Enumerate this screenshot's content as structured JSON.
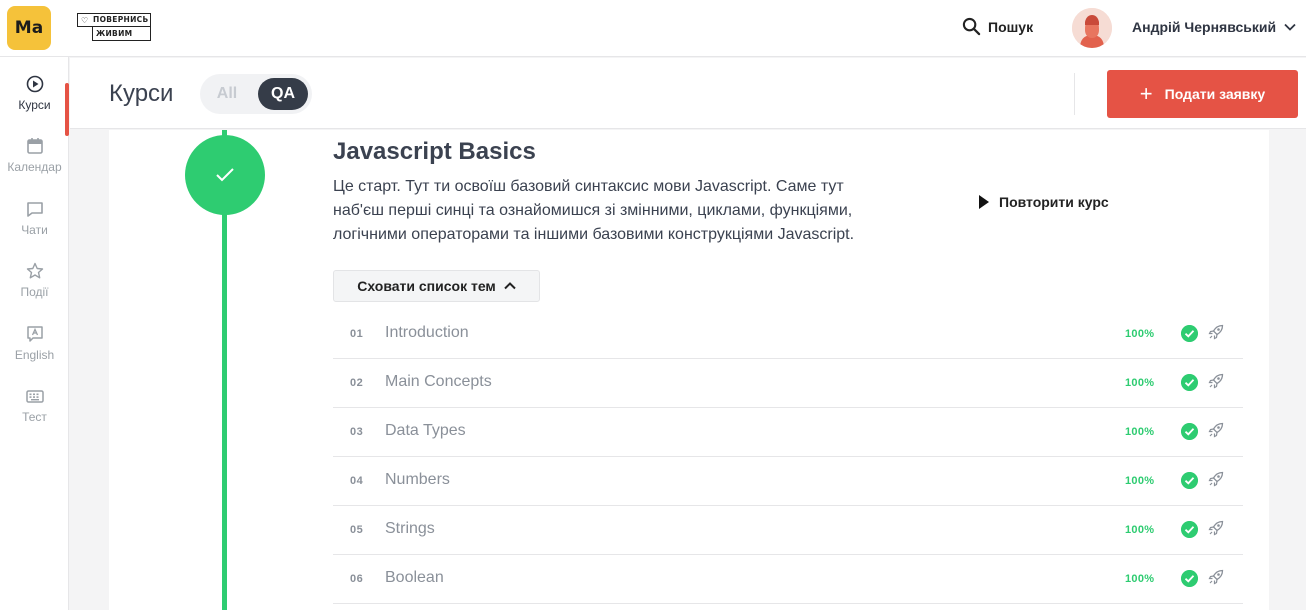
{
  "brand": {
    "logo_text": "Ma",
    "partner_line1": "ПОВЕРНИСЬ",
    "partner_line2": "ЖИВИМ"
  },
  "header": {
    "search_label": "Пошук",
    "username": "Андрій Чернявський"
  },
  "sidebar": {
    "items": [
      {
        "label": "Курси",
        "icon": "play-circle-icon",
        "active": true
      },
      {
        "label": "Календар",
        "icon": "calendar-icon",
        "active": false
      },
      {
        "label": "Чати",
        "icon": "chat-icon",
        "active": false
      },
      {
        "label": "Події",
        "icon": "star-icon",
        "active": false
      },
      {
        "label": "English",
        "icon": "english-icon",
        "active": false
      },
      {
        "label": "Тест",
        "icon": "keyboard-icon",
        "active": false
      }
    ]
  },
  "subheader": {
    "title": "Курси",
    "filter_options": [
      "All",
      "QA"
    ],
    "filter_selected": "QA",
    "apply_button": "Подати заявку"
  },
  "course": {
    "title": "Javascript Basics",
    "description": "Це старт. Тут ти освоїш базовий синтаксис мови Javascript. Саме тут наб'єш перші синці та ознайомишся зі змінними, циклами, функціями, логічними операторами та іншими базовими конструкціями Javascript.",
    "repeat_label": "Повторити курс",
    "toggle_label": "Сховати список тем",
    "topics": [
      {
        "num": "01",
        "name": "Introduction",
        "progress": "100%"
      },
      {
        "num": "02",
        "name": "Main Concepts",
        "progress": "100%"
      },
      {
        "num": "03",
        "name": "Data Types",
        "progress": "100%"
      },
      {
        "num": "04",
        "name": "Numbers",
        "progress": "100%"
      },
      {
        "num": "05",
        "name": "Strings",
        "progress": "100%"
      },
      {
        "num": "06",
        "name": "Boolean",
        "progress": "100%"
      }
    ]
  },
  "colors": {
    "accent": "#e55345",
    "success": "#2ecc71",
    "dark": "#353c48",
    "brand_yellow": "#f5c23a"
  }
}
